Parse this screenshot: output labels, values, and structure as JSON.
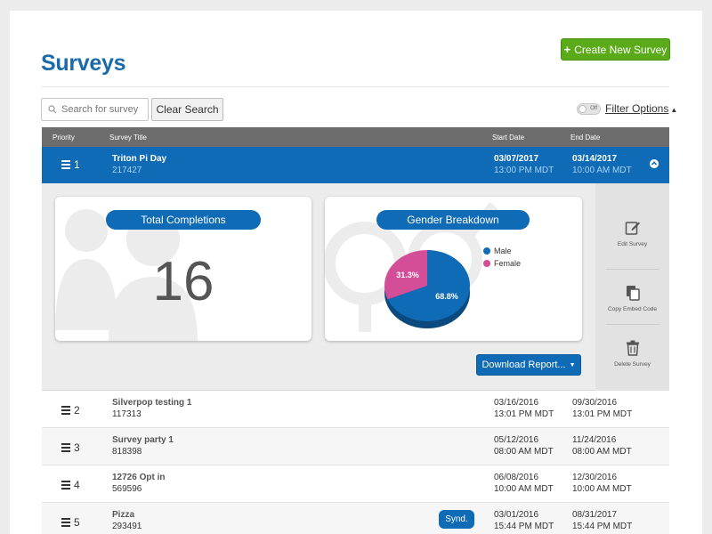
{
  "header": {
    "title": "Surveys",
    "create_label": "Create New Survey",
    "create_icon": "plus-icon"
  },
  "toolbar": {
    "search_placeholder": "Search for survey",
    "clear_label": "Clear Search",
    "toggle_label": "Off",
    "filter_label": "Filter Options"
  },
  "table": {
    "columns": [
      "Priority",
      "Survey Title",
      "Start Date",
      "End Date"
    ]
  },
  "active_survey": {
    "priority": "1",
    "title": "Triton Pi Day",
    "id": "217427",
    "start_date": "03/07/2017",
    "start_time": "13:00 PM MDT",
    "end_date": "03/14/2017",
    "end_time": "10:00 AM MDT",
    "completions_label": "Total Completions",
    "completions": "16",
    "gender_label": "Gender Breakdown",
    "download_label": "Download Report...",
    "actions": [
      "Edit Survey",
      "Copy Embed Code",
      "Delete Survey"
    ]
  },
  "chart_data": {
    "type": "pie",
    "title": "Gender Breakdown",
    "categories": [
      "Male",
      "Female"
    ],
    "values": [
      68.8,
      31.3
    ],
    "labels": [
      "68.8%",
      "31.3%"
    ],
    "colors": [
      "#0f6bb5",
      "#d44e97"
    ],
    "legend": "right"
  },
  "rows": [
    {
      "priority": "2",
      "title": "Silverpop testing 1",
      "id": "117313",
      "start_date": "03/16/2016",
      "start_time": "13:01 PM MDT",
      "end_date": "09/30/2016",
      "end_time": "13:01 PM MDT",
      "badge": ""
    },
    {
      "priority": "3",
      "title": "Survey party 1",
      "id": "818398",
      "start_date": "05/12/2016",
      "start_time": "08:00 AM MDT",
      "end_date": "11/24/2016",
      "end_time": "08:00 AM MDT",
      "badge": ""
    },
    {
      "priority": "4",
      "title": "12726 Opt in",
      "id": "569596",
      "start_date": "06/08/2016",
      "start_time": "10:00 AM MDT",
      "end_date": "12/30/2016",
      "end_time": "10:00 AM MDT",
      "badge": ""
    },
    {
      "priority": "5",
      "title": "Pizza",
      "id": "293491",
      "start_date": "03/01/2016",
      "start_time": "15:44 PM MDT",
      "end_date": "08/31/2017",
      "end_time": "15:44 PM MDT",
      "badge": "Synd."
    }
  ]
}
